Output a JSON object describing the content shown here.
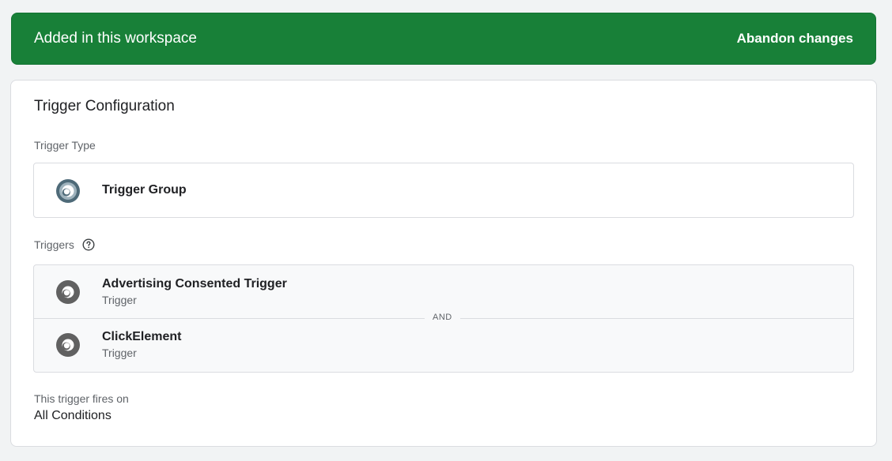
{
  "banner": {
    "title": "Added in this workspace",
    "action_label": "Abandon changes",
    "color": "#188038"
  },
  "card": {
    "title": "Trigger Configuration",
    "trigger_type": {
      "label": "Trigger Type",
      "name": "Trigger Group",
      "icon": "trigger-group-icon"
    },
    "triggers": {
      "label": "Triggers",
      "help_icon": "help-circle-icon",
      "connector": "AND",
      "items": [
        {
          "name": "Advertising Consented Trigger",
          "type": "Trigger",
          "icon": "trigger-icon"
        },
        {
          "name": "ClickElement",
          "type": "Trigger",
          "icon": "trigger-icon"
        }
      ]
    },
    "fires_on": {
      "label": "This trigger fires on",
      "value": "All Conditions"
    }
  }
}
